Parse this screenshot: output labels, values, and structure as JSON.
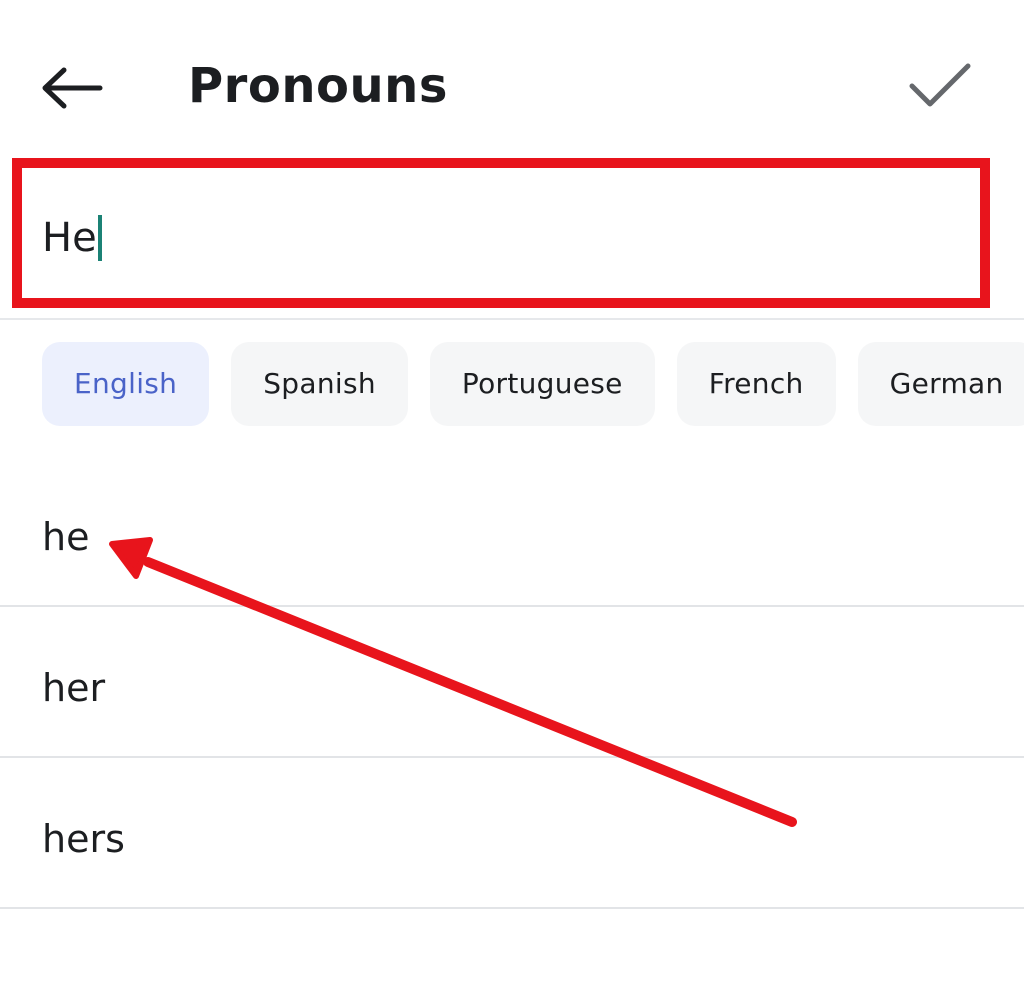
{
  "header": {
    "back_icon": "arrow-left-icon",
    "title": "Pronouns",
    "confirm_icon": "checkmark-icon"
  },
  "input": {
    "value": "He"
  },
  "languages": [
    {
      "label": "English",
      "selected": true
    },
    {
      "label": "Spanish",
      "selected": false
    },
    {
      "label": "Portuguese",
      "selected": false
    },
    {
      "label": "French",
      "selected": false
    },
    {
      "label": "German",
      "selected": false
    }
  ],
  "suggestions": [
    {
      "label": "he"
    },
    {
      "label": "her"
    },
    {
      "label": "hers"
    }
  ],
  "colors": {
    "highlight_box": "#e8141c",
    "annotation_arrow": "#e8141c",
    "selected_chip_text": "#4a63c8",
    "caret": "#1b8275"
  }
}
